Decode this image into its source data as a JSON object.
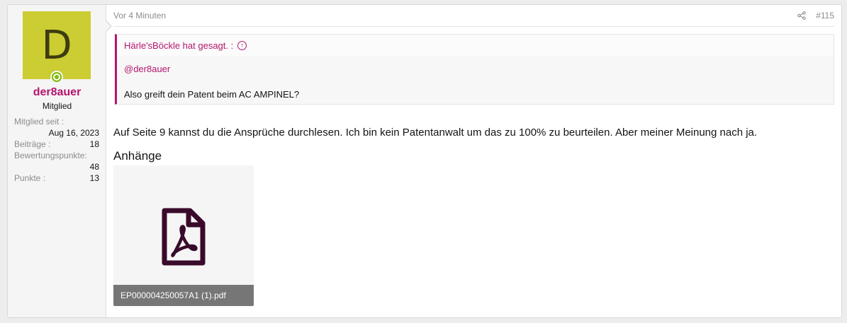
{
  "user": {
    "avatar_letter": "D",
    "avatar_color": "#cccc33",
    "username": "der8auer",
    "title": "Mitglied",
    "online": true,
    "stats": {
      "joined_label": "Mitglied seit :",
      "joined_value": "Aug 16, 2023",
      "posts_label": "Beiträge :",
      "posts_value": "18",
      "reactions_label": "Bewertungspunkte:",
      "reactions_value": "48",
      "points_label": "Punkte :",
      "points_value": "13"
    }
  },
  "post": {
    "time": "Vor 4 Minuten",
    "number": "#115",
    "quote": {
      "author_line": "Härle'sBöckle hat gesagt. :",
      "mention": "@der8auer",
      "text": "Also greift dein Patent beim AC AMPINEL?"
    },
    "message": "Auf Seite 9 kannst du die Ansprüche durchlesen. Ich bin kein Patentanwalt um das zu 100% zu beurteilen. Aber meiner Meinung nach ja.",
    "attachments_title": "Anhänge",
    "attachment": {
      "filename": "EP000004250057A1 (1).pdf",
      "icon": "pdf-file-icon"
    }
  },
  "colors": {
    "accent": "#b5156e",
    "online": "#7fb900",
    "pdf_icon": "#3a0a2a"
  }
}
